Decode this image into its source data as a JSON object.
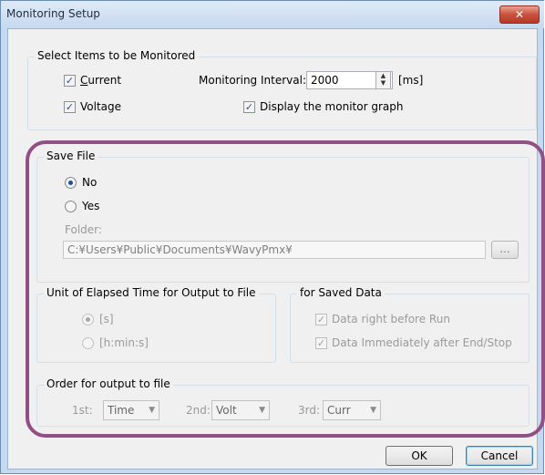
{
  "window": {
    "title": "Monitoring Setup",
    "close_glyph": "✕"
  },
  "monitor_items": {
    "group_title": "Select Items to be Monitored",
    "current": {
      "label": "Current",
      "checked": true
    },
    "voltage": {
      "label": "Voltage",
      "checked": true
    },
    "interval_label": "Monitoring Interval:",
    "interval_value": "2000",
    "interval_unit": "[ms]",
    "display_graph": {
      "label": "Display the monitor graph",
      "checked": true
    }
  },
  "save_file": {
    "group_title": "Save File",
    "no_label": "No",
    "yes_label": "Yes",
    "selected": "No",
    "folder_label": "Folder:",
    "folder_value": "C:¥Users¥Public¥Documents¥WavyPmx¥",
    "browse_label": "..."
  },
  "elapsed_unit": {
    "group_title": "Unit of Elapsed Time for Output to File",
    "seconds_label": "[s]",
    "hms_label": "[h:min:s]",
    "selected": "[s]"
  },
  "saved_data": {
    "group_title": "for Saved Data",
    "before_run": {
      "label": "Data right before Run",
      "checked": true
    },
    "after_end": {
      "label": "Data Immediately after End/Stop",
      "checked": true
    }
  },
  "order": {
    "group_title": "Order for output to file",
    "first_label": "1st:",
    "first_value": "Time",
    "second_label": "2nd:",
    "second_value": "Volt",
    "third_label": "3rd:",
    "third_value": "Curr"
  },
  "buttons": {
    "ok_label": "OK",
    "cancel_label": "Cancel"
  },
  "glyphs": {
    "check": "✓",
    "dropdown": "▼",
    "spin_up": "▲",
    "spin_down": "▼"
  },
  "colors": {
    "highlight": "#924f83",
    "title_bar": "#c6d9ef",
    "close_button": "#c9513d"
  }
}
